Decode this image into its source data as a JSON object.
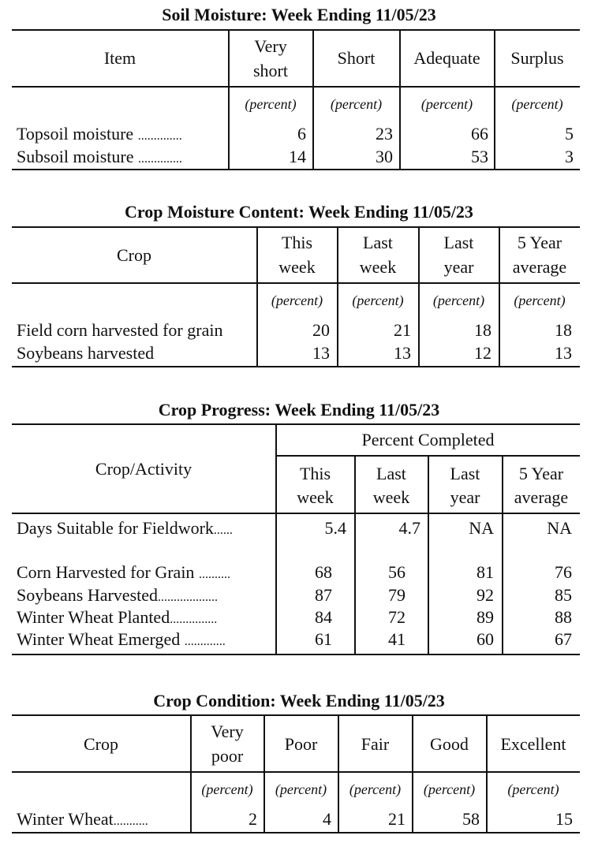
{
  "soil_moisture": {
    "title": "Soil Moisture: Week Ending 11/05/23",
    "headers": [
      "Item",
      "Very short",
      "Short",
      "Adequate",
      "Surplus"
    ],
    "header_lines": [
      [
        "Item"
      ],
      [
        "Very",
        "short"
      ],
      [
        "Short"
      ],
      [
        "Adequate"
      ],
      [
        "Surplus"
      ]
    ],
    "unit": "(percent)",
    "rows": [
      {
        "label": "Topsoil moisture",
        "leader": "..............",
        "values": [
          "6",
          "23",
          "66",
          "5"
        ]
      },
      {
        "label": "Subsoil moisture",
        "leader": "..............",
        "values": [
          "14",
          "30",
          "53",
          "3"
        ]
      }
    ]
  },
  "crop_moisture": {
    "title": "Crop Moisture Content: Week Ending 11/05/23",
    "header_lines": [
      [
        "Crop"
      ],
      [
        "This",
        "week"
      ],
      [
        "Last",
        "week"
      ],
      [
        "Last",
        "year"
      ],
      [
        "5 Year",
        "average"
      ]
    ],
    "unit": "(percent)",
    "rows": [
      {
        "label": "Field corn harvested for grain",
        "leader": "",
        "values": [
          "20",
          "21",
          "18",
          "18"
        ]
      },
      {
        "label": "Soybeans harvested",
        "leader": "",
        "values": [
          "13",
          "13",
          "12",
          "13"
        ]
      }
    ]
  },
  "crop_progress": {
    "title": "Crop Progress: Week Ending 11/05/23",
    "row_header": "Crop/Activity",
    "group_header": "Percent Completed",
    "header_lines": [
      [
        "This",
        "week"
      ],
      [
        "Last",
        "week"
      ],
      [
        "Last",
        "year"
      ],
      [
        "5 Year",
        "average"
      ]
    ],
    "rows": [
      {
        "label": "Days Suitable for Fieldwork",
        "leader": "......",
        "values": [
          "5.4",
          "4.7",
          "NA",
          "NA"
        ]
      },
      {
        "label": "Corn Harvested for Grain",
        "leader": "..........",
        "values": [
          "68",
          "56",
          "81",
          "76"
        ]
      },
      {
        "label": "Soybeans Harvested",
        "leader": "...................",
        "values": [
          "87",
          "79",
          "92",
          "85"
        ]
      },
      {
        "label": "Winter Wheat Planted",
        "leader": "...............",
        "values": [
          "84",
          "72",
          "89",
          "88"
        ]
      },
      {
        "label": "Winter Wheat Emerged",
        "leader": ".............",
        "values": [
          "61",
          "41",
          "60",
          "67"
        ]
      }
    ]
  },
  "crop_condition": {
    "title": "Crop Condition: Week Ending 11/05/23",
    "header_lines": [
      [
        "Crop"
      ],
      [
        "Very",
        "poor"
      ],
      [
        "Poor"
      ],
      [
        "Fair"
      ],
      [
        "Good"
      ],
      [
        "Excellent"
      ]
    ],
    "unit": "(percent)",
    "rows": [
      {
        "label": "Winter Wheat",
        "leader": "...........",
        "values": [
          "2",
          "4",
          "21",
          "58",
          "15"
        ]
      }
    ]
  }
}
